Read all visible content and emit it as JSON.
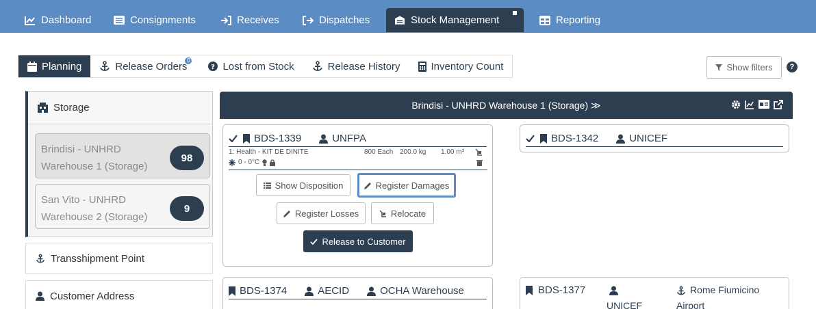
{
  "topnav": {
    "items": [
      {
        "label": "Dashboard",
        "icon": "line-chart-icon"
      },
      {
        "label": "Consignments",
        "icon": "list-icon"
      },
      {
        "label": "Receives",
        "icon": "sign-in-icon"
      },
      {
        "label": "Dispatches",
        "icon": "sign-out-icon"
      },
      {
        "label": "Stock Management",
        "icon": "warehouse-icon"
      },
      {
        "label": "Reporting",
        "icon": "table-icon"
      }
    ],
    "active": "Stock Management"
  },
  "subtabs": {
    "planning": "Planning",
    "release_orders": "Release Orders",
    "release_orders_badge": "0",
    "lost_from_stock": "Lost from Stock",
    "release_history": "Release History",
    "inventory_count": "Inventory Count"
  },
  "filters": {
    "show_filters": "Show filters"
  },
  "left": {
    "storage_heading": "Storage",
    "warehouses": [
      {
        "line1": "Brindisi - UNHRD",
        "line2": "Warehouse 1 (Storage)",
        "count": "98"
      },
      {
        "line1": "San Vito - UNHRD",
        "line2": "Warehouse 2 (Storage)",
        "count": "9"
      }
    ],
    "transshipment": "Transshipment Point",
    "customer_address": "Customer Address"
  },
  "storage_header": {
    "title": "Brindisi - UNHRD Warehouse 1 (Storage) ≫"
  },
  "cards": {
    "c1": {
      "id": "BDS-1339",
      "owner": "UNFPA",
      "item": "1: Health - KIT DE DINITE",
      "qty": "800 Each",
      "weight": "200.0 kg",
      "volume": "1.00 m³",
      "temp": "0 - 0°C",
      "actions": {
        "show_disposition": "Show Disposition",
        "register_damages": "Register Damages",
        "register_losses": "Register Losses",
        "relocate": "Relocate",
        "release": "Release to Customer"
      }
    },
    "c2": {
      "id": "BDS-1342",
      "owner": "UNICEF"
    },
    "c3": {
      "id": "BDS-1374",
      "owner": "AECID",
      "destination": "OCHA Warehouse"
    },
    "c4": {
      "id": "BDS-1377",
      "owner": "UNICEF",
      "destination_line1": "Rome Fiumicino",
      "destination_line2": "Airport"
    }
  },
  "colors": {
    "nav_bg": "#5b8dc4",
    "dark": "#2c3e50",
    "highlight": "#5b8dc4"
  }
}
